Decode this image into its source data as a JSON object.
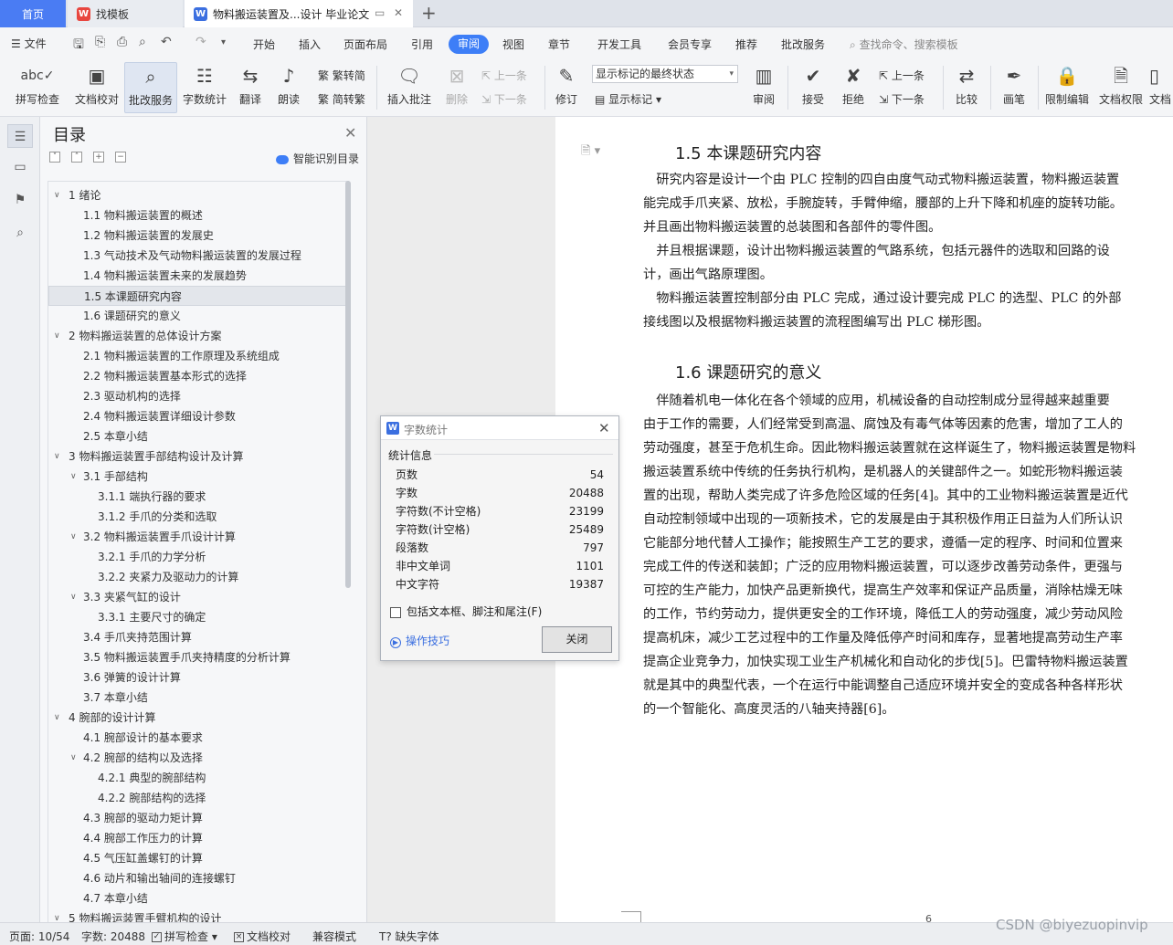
{
  "tabs": {
    "home": "首页",
    "template": "找模板",
    "document": "物料搬运装置及...设计 毕业论文"
  },
  "menubar": {
    "file": "文件",
    "items": [
      "开始",
      "插入",
      "页面布局",
      "引用",
      "审阅",
      "视图",
      "章节",
      "开发工具",
      "会员专享",
      "推荐",
      "批改服务"
    ],
    "active": "审阅",
    "search_placeholder": "查找命令、搜索模板"
  },
  "ribbon": {
    "spell": "拼写检查",
    "proof": "文档校对",
    "correction": "批改服务",
    "wordcount": "字数统计",
    "translate": "翻译",
    "read": "朗读",
    "to_traditional": "繁转简",
    "to_simplified": "简转繁",
    "insert_comment": "插入批注",
    "delete": "删除",
    "prev_comment": "上一条",
    "next_comment": "下一条",
    "revise": "修订",
    "markup_combo": "显示标记的最终状态",
    "show_markup": "显示标记",
    "review": "审阅",
    "accept": "接受",
    "reject": "拒绝",
    "prev": "上一条",
    "next": "下一条",
    "compare": "比较",
    "pen": "画笔",
    "restrict": "限制编辑",
    "doc_rights": "文档权限",
    "doc_more": "文档"
  },
  "toc": {
    "title": "目录",
    "smart": "智能识别目录",
    "items": [
      {
        "level": 1,
        "text": "1  绪论"
      },
      {
        "level": 2,
        "text": "1.1  物料搬运装置的概述"
      },
      {
        "level": 2,
        "text": "1.2  物料搬运装置的发展史"
      },
      {
        "level": 2,
        "text": "1.3  气动技术及气动物料搬运装置的发展过程"
      },
      {
        "level": 2,
        "text": "1.4  物料搬运装置未来的发展趋势"
      },
      {
        "level": 2,
        "text": "1.5  本课题研究内容"
      },
      {
        "level": 2,
        "text": "1.6  课题研究的意义"
      },
      {
        "level": 1,
        "text": "2  物料搬运装置的总体设计方案"
      },
      {
        "level": 2,
        "text": "2.1  物料搬运装置的工作原理及系统组成"
      },
      {
        "level": 2,
        "text": "2.2  物料搬运装置基本形式的选择"
      },
      {
        "level": 2,
        "text": "2.3  驱动机构的选择"
      },
      {
        "level": 2,
        "text": "2.4  物料搬运装置详细设计参数"
      },
      {
        "level": 2,
        "text": "2.5  本章小结"
      },
      {
        "level": 1,
        "text": "3  物料搬运装置手部结构设计及计算"
      },
      {
        "level": 2,
        "text": "3.1  手部结构",
        "expand": true
      },
      {
        "level": 3,
        "text": "3.1.1  端执行器的要求"
      },
      {
        "level": 3,
        "text": "3.1.2  手爪的分类和选取"
      },
      {
        "level": 2,
        "text": "3.2  物料搬运装置手爪设计计算",
        "expand": true
      },
      {
        "level": 3,
        "text": "3.2.1  手爪的力学分析"
      },
      {
        "level": 3,
        "text": "3.2.2  夹紧力及驱动力的计算"
      },
      {
        "level": 2,
        "text": "3.3  夹紧气缸的设计",
        "expand": true
      },
      {
        "level": 3,
        "text": "3.3.1  主要尺寸的确定"
      },
      {
        "level": 2,
        "text": "3.4  手爪夹持范围计算"
      },
      {
        "level": 2,
        "text": "3.5  物料搬运装置手爪夹持精度的分析计算"
      },
      {
        "level": 2,
        "text": "3.6  弹簧的设计计算"
      },
      {
        "level": 2,
        "text": "3.7  本章小结"
      },
      {
        "level": 1,
        "text": "4  腕部的设计计算"
      },
      {
        "level": 2,
        "text": "4.1  腕部设计的基本要求"
      },
      {
        "level": 2,
        "text": "4.2  腕部的结构以及选择",
        "expand": true
      },
      {
        "level": 3,
        "text": "4.2.1  典型的腕部结构"
      },
      {
        "level": 3,
        "text": "4.2.2  腕部结构的选择"
      },
      {
        "level": 2,
        "text": "4.3  腕部的驱动力矩计算"
      },
      {
        "level": 2,
        "text": "4.4  腕部工作压力的计算"
      },
      {
        "level": 2,
        "text": "4.5  气压缸盖螺钉的计算"
      },
      {
        "level": 2,
        "text": "4.6  动片和输出轴间的连接螺钉"
      },
      {
        "level": 2,
        "text": "4.7  本章小结"
      },
      {
        "level": 1,
        "text": "5  物料搬运装置手臂机构的设计"
      }
    ]
  },
  "page": {
    "h1": "1.5  本课题研究内容",
    "p1": [
      "　研究内容是设计一个由 PLC 控制的四自由度气动式物料搬运装置，物料搬运装置",
      "能完成手爪夹紧、放松，手腕旋转，手臂伸缩，腰部的上升下降和机座的旋转功能。",
      "并且画出物料搬运装置的总装图和各部件的零件图。",
      "　并且根据课题，设计出物料搬运装置的气路系统，包括元器件的选取和回路的设",
      "计，画出气路原理图。",
      "　物料搬运装置控制部分由 PLC 完成，通过设计要完成 PLC 的选型、PLC 的外部",
      "接线图以及根据物料搬运装置的流程图编写出 PLC 梯形图。"
    ],
    "h2": "1.6  课题研究的意义",
    "p2": [
      "　伴随着机电一体化在各个领域的应用，机械设备的自动控制成分显得越来越重要",
      "由于工作的需要，人们经常受到高温、腐蚀及有毒气体等因素的危害，增加了工人的",
      "劳动强度，甚至于危机生命。因此物料搬运装置就在这样诞生了，物料搬运装置是物料",
      "搬运装置系统中传统的任务执行机构，是机器人的关键部件之一。如蛇形物料搬运装",
      "置的出现，帮助人类完成了许多危险区域的任务[4]。其中的工业物料搬运装置是近代",
      "自动控制领域中出现的一项新技术，它的发展是由于其积极作用正日益为人们所认识",
      "它能部分地代替人工操作；能按照生产工艺的要求，遵循一定的程序、时间和位置来",
      "完成工件的传送和装卸；广泛的应用物料搬运装置，可以逐步改善劳动条件，更强与",
      "可控的生产能力，加快产品更新换代，提高生产效率和保证产品质量，消除枯燥无味",
      "的工作，节约劳动力，提供更安全的工作环境，降低工人的劳动强度，减少劳动风险",
      "提高机床，减少工艺过程中的工作量及降低停产时间和库存，显著地提高劳动生产率",
      "提高企业竞争力，加快实现工业生产机械化和自动化的步伐[5]。巴雷特物料搬运装置",
      "就是其中的典型代表，一个在运行中能调整自己适应环境并安全的变成各种各样形状",
      "的一个智能化、高度灵活的八轴夹持器[6]。"
    ],
    "page_number": "6"
  },
  "dialog": {
    "title": "字数统计",
    "section": "统计信息",
    "stats": [
      {
        "label": "页数",
        "value": "54"
      },
      {
        "label": "字数",
        "value": "20488"
      },
      {
        "label": "字符数(不计空格)",
        "value": "23199"
      },
      {
        "label": "字符数(计空格)",
        "value": "25489"
      },
      {
        "label": "段落数",
        "value": "797"
      },
      {
        "label": "非中文单词",
        "value": "1101"
      },
      {
        "label": "中文字符",
        "value": "19387"
      }
    ],
    "checkbox": "包括文本框、脚注和尾注(F)",
    "tips": "操作技巧",
    "close": "关闭"
  },
  "status": {
    "page": "页面: 10/54",
    "words": "字数: 20488",
    "spell": "拼写检查",
    "proof": "文档校对",
    "compat": "兼容模式",
    "missing_font": "缺失字体"
  },
  "watermark": "CSDN @biyezuopinvip",
  "colors": {
    "accent": "#3d7ef7",
    "home_tab": "#4a7cf3"
  }
}
